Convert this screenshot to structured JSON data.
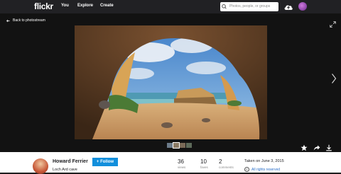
{
  "nav": {
    "logo": "flickr",
    "links": [
      {
        "label": "You"
      },
      {
        "label": "Explore"
      },
      {
        "label": "Create"
      }
    ],
    "search_placeholder": "Photos, people, or groups",
    "upload_icon": "cloud-upload-icon",
    "accent": "#128fdc"
  },
  "viewer": {
    "back_label": "Back to photostream",
    "expand_icon": "expand-icon",
    "next_icon": "chevron-right-icon",
    "thumbnail_count": 4,
    "actions": [
      {
        "icon": "star-icon"
      },
      {
        "icon": "share-icon"
      },
      {
        "icon": "download-icon"
      }
    ]
  },
  "photo_info": {
    "owner": "Howard Ferrier",
    "title": "Loch Ard cave",
    "follow_label": "+ Follow",
    "stats": [
      {
        "value": "36",
        "label": "views"
      },
      {
        "value": "10",
        "label": "faves"
      },
      {
        "value": "2",
        "label": "comments"
      }
    ],
    "taken": "Taken on June 3, 2015",
    "rights": "All rights reserved",
    "rights_icon": "copyright-icon"
  }
}
